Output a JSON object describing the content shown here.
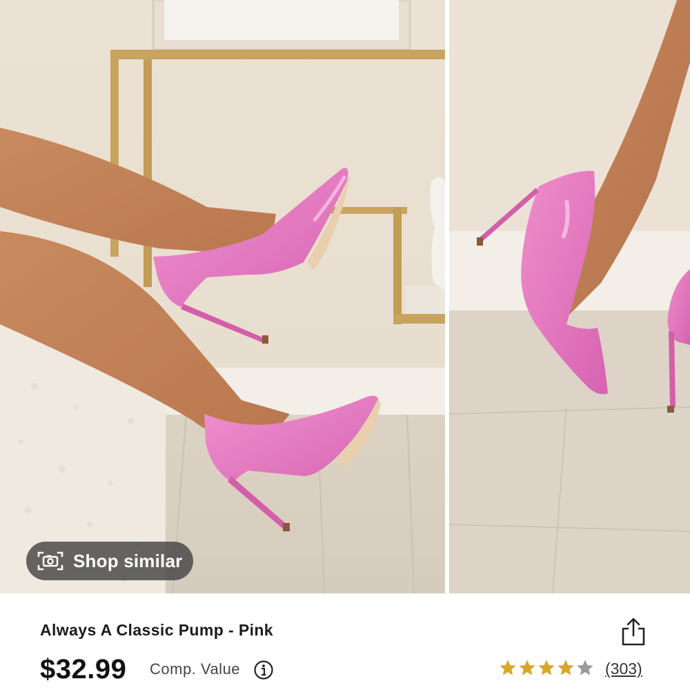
{
  "gallery": {
    "shop_similar_label": "Shop similar"
  },
  "product": {
    "title": "Always A Classic Pump - Pink",
    "price": "$32.99",
    "comp_value_label": "Comp. Value",
    "rating": 4.5,
    "rating_max": 5,
    "review_count": "(303)"
  },
  "colors": {
    "shoe_pink": "#e67ac2",
    "star_gold": "#d9a62a",
    "star_gray": "#9a9a9a",
    "pill_bg": "#464646"
  },
  "icons": {
    "shop_similar": "camera-icon",
    "share": "share-icon",
    "info": "info-icon",
    "rating": "star-icon"
  }
}
